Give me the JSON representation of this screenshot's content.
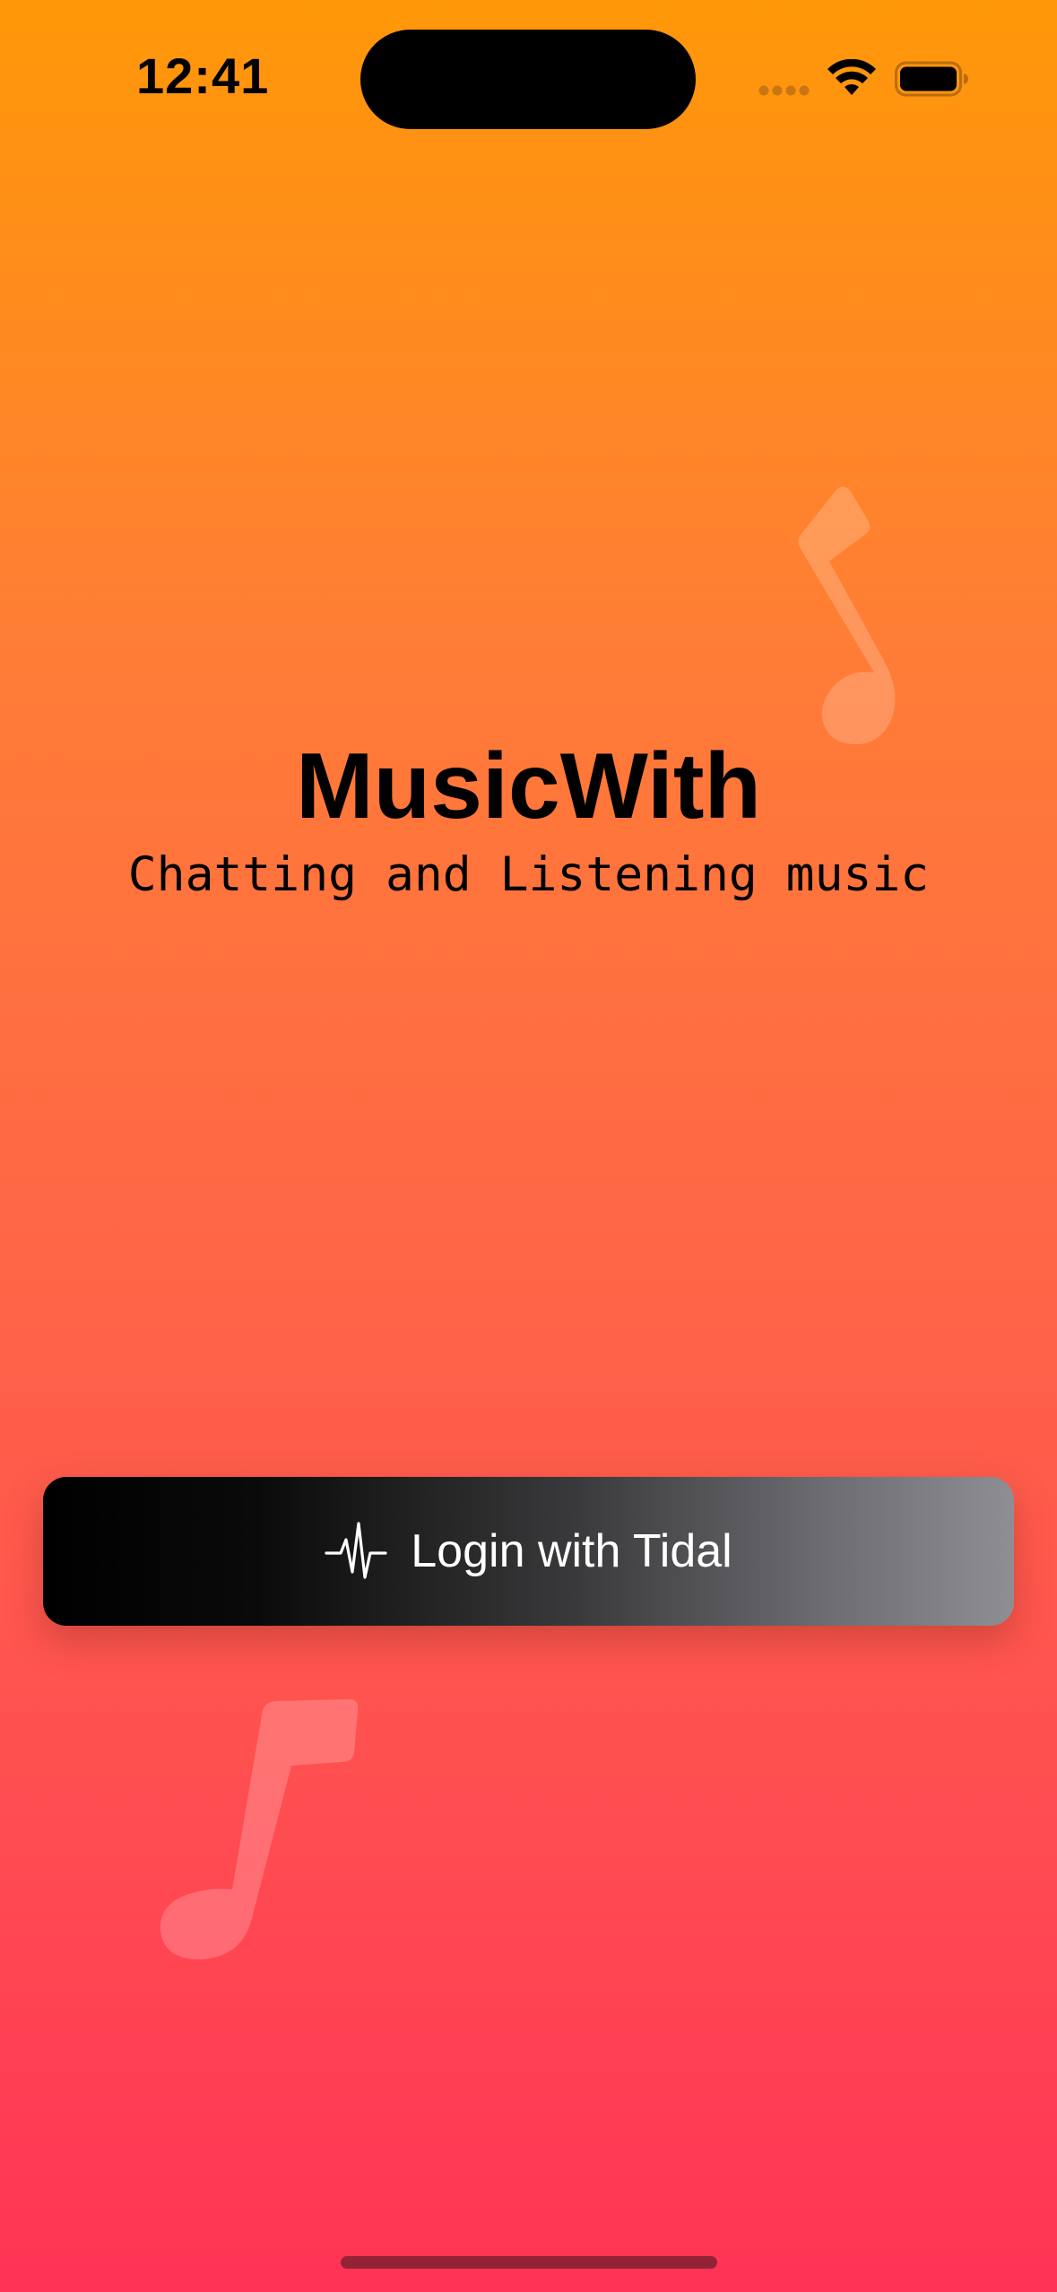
{
  "status_bar": {
    "time": "12:41"
  },
  "app": {
    "title": "MusicWith",
    "subtitle": "Chatting and Listening music"
  },
  "login": {
    "label": "Login with Tidal",
    "icon": "waveform-pulse-icon"
  },
  "colors": {
    "gradient_top": "#ff9808",
    "gradient_bottom": "#ff3355",
    "button_start": "#000000",
    "button_end": "#8e8e93",
    "text_primary": "#000000",
    "button_text": "#ffffff"
  },
  "decorations": {
    "icons": [
      "music-note-icon",
      "music-note-icon"
    ]
  }
}
